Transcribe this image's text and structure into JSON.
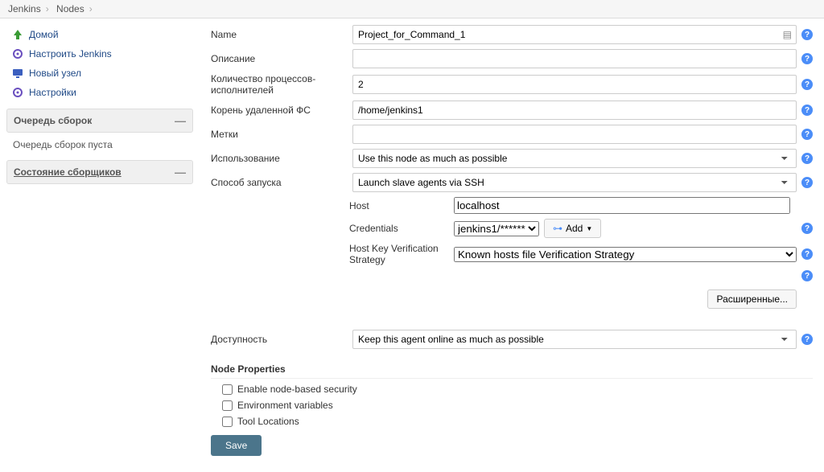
{
  "breadcrumb": {
    "items": [
      "Jenkins",
      "Nodes"
    ]
  },
  "sidebar": {
    "links": [
      {
        "icon": "arrow-up",
        "color": "#3a9b35",
        "label": "Домой"
      },
      {
        "icon": "gear",
        "color": "#6a4fbf",
        "label": "Настроить Jenkins"
      },
      {
        "icon": "monitor",
        "color": "#3b5fbf",
        "label": "Новый узел"
      },
      {
        "icon": "gear",
        "color": "#6a4fbf",
        "label": "Настройки"
      }
    ],
    "box1": {
      "title": "Очередь сборок",
      "toggle": "—"
    },
    "box1_text": "Очередь сборок пуста",
    "box2": {
      "title": "Состояние сборщиков",
      "toggle": "—"
    }
  },
  "form": {
    "name": {
      "label": "Name",
      "value": "Project_for_Command_1"
    },
    "desc": {
      "label": "Описание",
      "value": ""
    },
    "executors": {
      "label": "Количество процессов-исполнителей",
      "value": "2"
    },
    "root": {
      "label": "Корень удаленной ФС",
      "value": "/home/jenkins1"
    },
    "labels": {
      "label": "Метки",
      "value": ""
    },
    "usage": {
      "label": "Использование",
      "value": "Use this node as much as possible"
    },
    "launch": {
      "label": "Способ запуска",
      "value": "Launch slave agents via SSH"
    },
    "host": {
      "label": "Host",
      "value": "localhost"
    },
    "credentials": {
      "label": "Credentials",
      "value": "jenkins1/******",
      "add": "Add"
    },
    "hostkey": {
      "label": "Host Key Verification Strategy",
      "value": "Known hosts file Verification Strategy"
    },
    "advanced": "Расширенные...",
    "availability": {
      "label": "Доступность",
      "value": "Keep this agent online as much as possible"
    }
  },
  "nodeprops": {
    "title": "Node Properties",
    "items": [
      "Enable node-based security",
      "Environment variables",
      "Tool Locations"
    ]
  },
  "save": "Save"
}
